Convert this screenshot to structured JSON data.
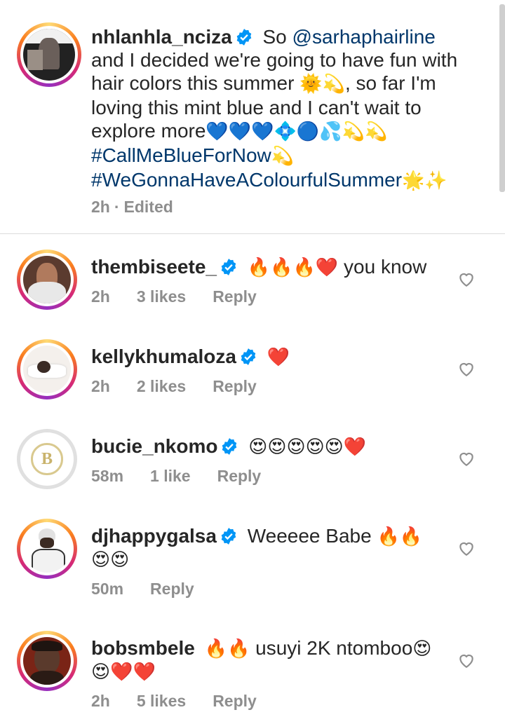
{
  "caption": {
    "username": "nhlanhla_nciza",
    "text_before_mention": "So",
    "mention": "@sarhaphairline",
    "line_2": "and I decided we're going to have fun with",
    "line_3": "hair colors this summer",
    "line_3_emoji": "🌞💫",
    "line_3_tail": ", so far I'm",
    "line_4": "loving this mint blue and I can't wait to",
    "line_5": "explore more",
    "line_5_emoji": "💙💙💙💠🔵💦💫💫",
    "hashtag_1": "#CallMeBlueForNow",
    "hashtag_1_emoji": "💫",
    "hashtag_2": "#WeGonnaHaveAColourfulSummer",
    "hashtag_2_emoji": "🌟✨",
    "time": "2h",
    "separator": "·",
    "edited": "Edited"
  },
  "comments": [
    {
      "username": "thembiseete_",
      "verified": true,
      "emoji": "🔥🔥🔥❤️",
      "text": "you know",
      "time": "2h",
      "likes": "3 likes",
      "reply": "Reply"
    },
    {
      "username": "kellykhumaloza",
      "verified": true,
      "emoji": "❤️",
      "text": "",
      "time": "2h",
      "likes": "2 likes",
      "reply": "Reply"
    },
    {
      "username": "bucie_nkomo",
      "verified": true,
      "emoji": "😍😍😍😍😍❤️",
      "text": "",
      "time": "58m",
      "likes": "1 like",
      "reply": "Reply"
    },
    {
      "username": "djhappygalsa",
      "verified": true,
      "text": "Weeeee Babe",
      "emoji": "🔥🔥",
      "emoji_line2": "😍😍",
      "time": "50m",
      "likes": "",
      "reply": "Reply"
    },
    {
      "username": "bobsmbele",
      "verified": false,
      "emoji": "🔥🔥",
      "text": "usuyi 2K ntomboo",
      "emoji_tail": "😍",
      "emoji_line2": "😍❤️❤️",
      "time": "2h",
      "likes": "5 likes",
      "reply": "Reply"
    }
  ],
  "colors": {
    "verified_badge": "#0095f6",
    "link": "#00376b",
    "meta": "#8e8e8e"
  },
  "icons": {
    "like": "heart-outline-icon",
    "verified": "verified-badge-icon"
  }
}
